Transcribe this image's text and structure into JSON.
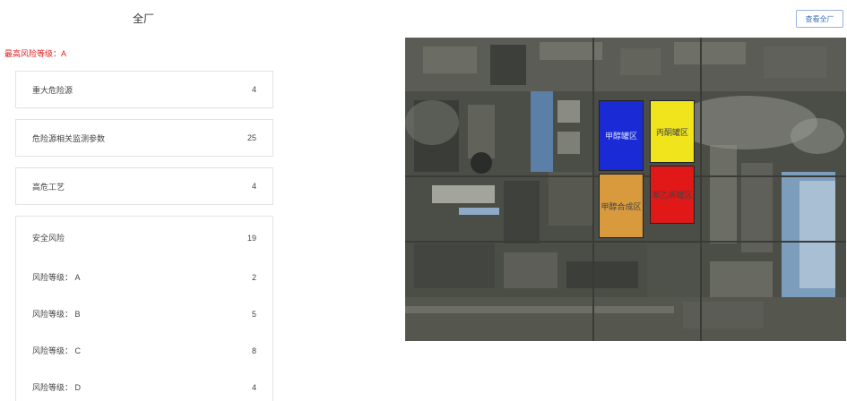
{
  "header": {
    "title": "全厂",
    "view_button": "查看全厂"
  },
  "risk": {
    "max_level_label": "最高风险等级：",
    "max_level_value": "A"
  },
  "cards": {
    "major_hazard": {
      "label": "重大危险源",
      "value": "4"
    },
    "monitor_params": {
      "label": "危险源相关监测参数",
      "value": "25"
    },
    "high_risk_process": {
      "label": "高危工艺",
      "value": "4"
    },
    "safety_risk": {
      "label": "安全风险",
      "value": "19",
      "levels": [
        {
          "label": "风险等级： A",
          "value": "2"
        },
        {
          "label": "风险等级： B",
          "value": "5"
        },
        {
          "label": "风险等级： C",
          "value": "8"
        },
        {
          "label": "风险等级： D",
          "value": "4"
        }
      ]
    }
  },
  "map": {
    "zones": [
      {
        "label": "甲醇罐区",
        "color": "#1a2bd6"
      },
      {
        "label": "丙酮罐区",
        "color": "#f0e41c"
      },
      {
        "label": "甲醇合成区",
        "color": "#d99a3e"
      },
      {
        "label": "苯乙烯罐区",
        "color": "#e01818"
      }
    ]
  }
}
